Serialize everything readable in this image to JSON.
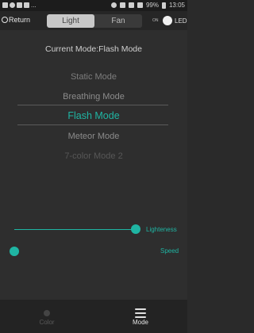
{
  "statusbar": {
    "left_text": "...",
    "time": "13:05",
    "battery": "99%"
  },
  "topbar": {
    "return_label": "Return",
    "tabs": [
      {
        "label": "Light",
        "active": true
      },
      {
        "label": "Fan",
        "active": false
      }
    ],
    "led_toggle_state": "ON",
    "led_label": "LED"
  },
  "main": {
    "current_mode": "Current Mode:Flash Mode",
    "modes": [
      "Static Mode",
      "Breathing Mode",
      "Flash Mode",
      "Meteor Mode",
      "7-color Mode 2"
    ],
    "selected_index": 2,
    "sliders": [
      {
        "label": "Lighteness",
        "value": 1.0
      },
      {
        "label": "Speed",
        "value": 0.0
      }
    ]
  },
  "bottombar": {
    "items": [
      {
        "label": "Color",
        "icon": "color-icon",
        "active": false
      },
      {
        "label": "Mode",
        "icon": "menu-icon",
        "active": true
      }
    ]
  },
  "colors": {
    "accent": "#1fb5a3",
    "background": "#2e2e2e"
  }
}
